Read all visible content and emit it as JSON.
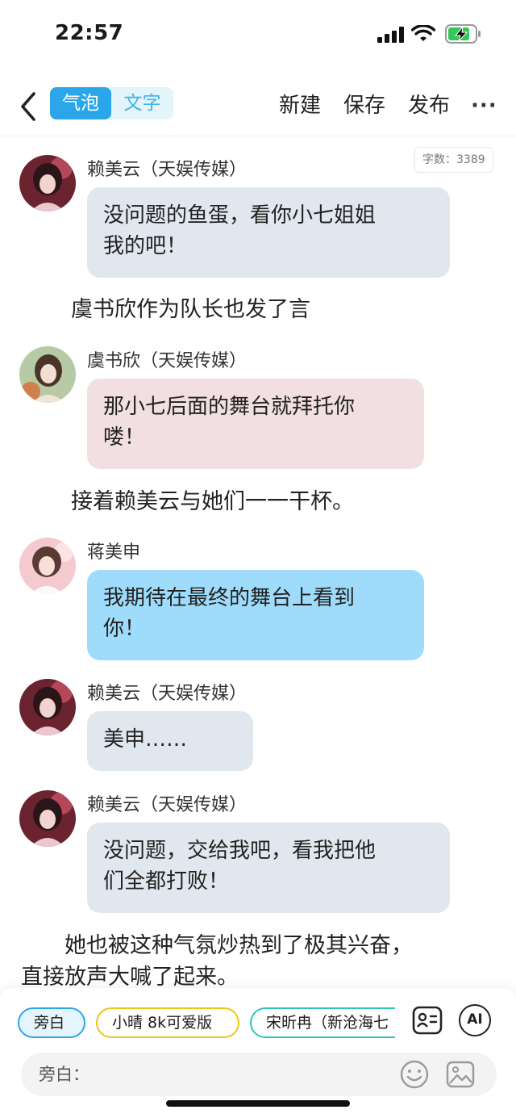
{
  "status": {
    "time": "22:57"
  },
  "nav": {
    "seg_bubble": "气泡",
    "seg_text": "文字",
    "new": "新建",
    "save": "保存",
    "publish": "发布",
    "more": "···"
  },
  "word_count": "字数：3389",
  "messages": [
    {
      "type": "chat",
      "name": "赖美云（天娱传媒）",
      "lines": [
        "没问题的鱼蛋，看你小七姐姐",
        "我的吧！"
      ],
      "bubble_color": "#e1e7ef"
    },
    {
      "type": "narration",
      "text": "虞书欣作为队长也发了言"
    },
    {
      "type": "chat",
      "name": "虞书欣（天娱传媒）",
      "lines": [
        "那小七后面的舞台就拜托你",
        "喽！"
      ],
      "bubble_color": "#f1dfe1"
    },
    {
      "type": "narration",
      "text": "接着赖美云与她们一一干杯。"
    },
    {
      "type": "chat",
      "name": "蒋美申",
      "lines": [
        "我期待在最终的舞台上看到",
        "你！"
      ],
      "bubble_color": "#9fdcfb"
    },
    {
      "type": "chat",
      "name": "赖美云（天娱传媒）",
      "lines": [
        "美申……"
      ],
      "bubble_color": "#e1e7ef"
    },
    {
      "type": "chat",
      "name": "赖美云（天娱传媒）",
      "lines": [
        "没问题，交给我吧，看我把他",
        "们全都打败！"
      ],
      "bubble_color": "#e1e7ef"
    },
    {
      "type": "narration",
      "lines": [
        "　　她也被这种气氛炒热到了极其兴奋，",
        "直接放声大喊了起来。"
      ]
    }
  ],
  "bottom": {
    "chips": [
      {
        "label": "旁白",
        "color": "#2ba6e8"
      },
      {
        "label": "小晴 8k可爱版",
        "color": "#f0c419"
      },
      {
        "label": "宋昕冉（新沧海七",
        "color": "#2ec4b6"
      }
    ],
    "icons": [
      "contact-card-icon",
      "ai-icon",
      "emoji-icon",
      "image-icon"
    ],
    "ai_label": "AI",
    "input_label": "旁白："
  }
}
